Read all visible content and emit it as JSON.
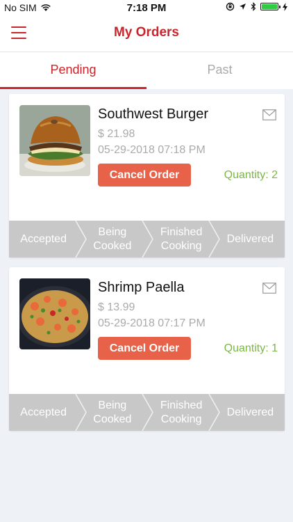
{
  "status_bar": {
    "carrier": "No SIM",
    "time": "7:18 PM"
  },
  "header": {
    "title": "My Orders"
  },
  "tabs": [
    {
      "label": "Pending",
      "active": true
    },
    {
      "label": "Past",
      "active": false
    }
  ],
  "orders": [
    {
      "name": "Southwest Burger",
      "price": "$ 21.98",
      "date": "05-29-2018 07:18 PM",
      "cancel_label": "Cancel Order",
      "quantity": "Quantity: 2"
    },
    {
      "name": "Shrimp Paella",
      "price": "$ 13.99",
      "date": "05-29-2018 07:17 PM",
      "cancel_label": "Cancel Order",
      "quantity": "Quantity: 1"
    }
  ],
  "steps": [
    "Accepted",
    "Being Cooked",
    "Finished Cooking",
    "Delivered"
  ],
  "colors": {
    "brand": "#c8252c",
    "cancel": "#e8624a",
    "quantity": "#7bb844",
    "step_bg": "#c8c8c8"
  }
}
